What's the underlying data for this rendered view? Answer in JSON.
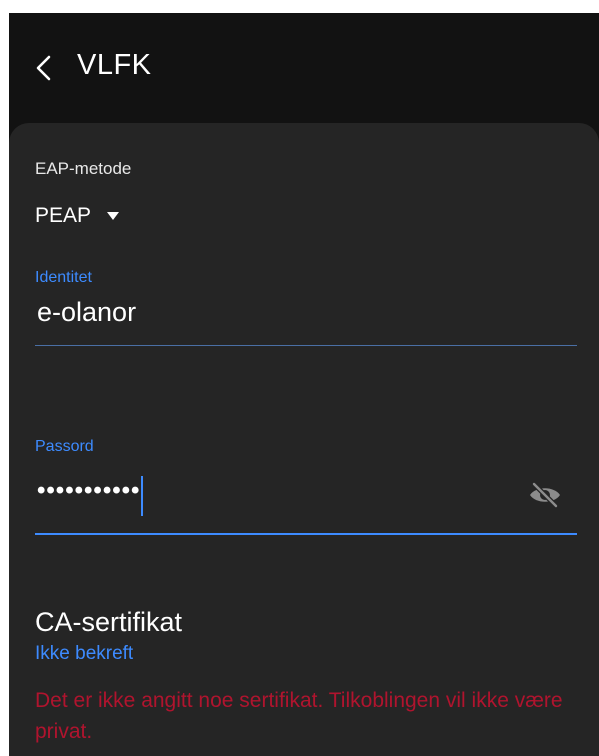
{
  "header": {
    "title": "VLFK"
  },
  "form": {
    "eap_method": {
      "label": "EAP-metode",
      "value": "PEAP"
    },
    "identity": {
      "label": "Identitet",
      "value": "e-olanor"
    },
    "password": {
      "label": "Passord",
      "masked_value": "•••••••••••"
    },
    "ca_certificate": {
      "label": "CA-sertifikat",
      "value": "Ikke bekreft",
      "warning": "Det er ikke angitt noe sertifikat. Tilkoblingen vil ikke være privat."
    }
  },
  "colors": {
    "accent": "#3d8bff",
    "warning": "#b0142e",
    "background": "#121212",
    "card": "#252525"
  },
  "icons": {
    "back": "chevron-left-icon",
    "dropdown": "caret-down-icon",
    "password_toggle": "eye-off-icon"
  }
}
